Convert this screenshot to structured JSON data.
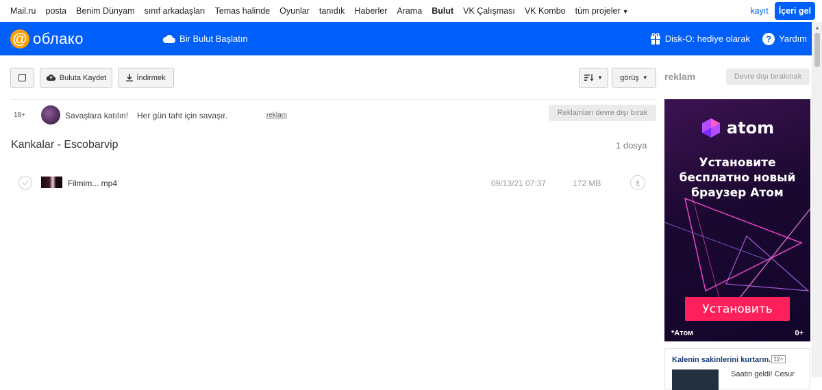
{
  "portal_nav": {
    "items": [
      {
        "label": "Mail.ru",
        "active": false
      },
      {
        "label": "posta",
        "active": false
      },
      {
        "label": "Benim Dünyam",
        "active": false
      },
      {
        "label": "sınıf arkadaşları",
        "active": false
      },
      {
        "label": "Temas halinde",
        "active": false
      },
      {
        "label": "Oyunlar",
        "active": false
      },
      {
        "label": "tanıdık",
        "active": false
      },
      {
        "label": "Haberler",
        "active": false
      },
      {
        "label": "Arama",
        "active": false
      },
      {
        "label": "Bulut",
        "active": true
      },
      {
        "label": "VK Çalışması",
        "active": false
      },
      {
        "label": "VK Kombo",
        "active": false
      }
    ],
    "more_label": "tüm projeler",
    "signup_label": "kayıt",
    "login_label": "İçeri gel"
  },
  "header": {
    "logo_symbol": "@",
    "logo_text": "облако",
    "promo_label": "Bir Bulut Başlatın",
    "disko_label": "Disk-O: hediye olarak",
    "help_label": "Yardım",
    "brand_color": "#005ff9"
  },
  "toolbar": {
    "save_label": "Buluta Kaydet",
    "download_label": "İndirmek",
    "view_label": "görüş"
  },
  "ads": {
    "label": "reklam",
    "disable_label": "Devre dışı bırakmak",
    "bar": {
      "age": "18+",
      "title": "Savaşlara katılın!",
      "text": "Her gün taht için savaşır.",
      "tag": "reklam",
      "hide_label": "Reklamları devre dışı bırak"
    },
    "banner": {
      "brand": "atom",
      "text": "Установите\nбесплатно новый\nбраузер Атом",
      "cta": "Установить",
      "footer": "*Атом",
      "age": "0+"
    },
    "card": {
      "title": "Kalenin sakinlerini kurtarın.",
      "age": "12+",
      "text": "Saatin geldi! Cesur"
    }
  },
  "folder": {
    "title": "Kankalar - Escobarvip",
    "count": "1 dosya"
  },
  "files": [
    {
      "name": "Filmim... mp4",
      "date": "09/13/21 07:37",
      "size": "172 MB"
    }
  ]
}
